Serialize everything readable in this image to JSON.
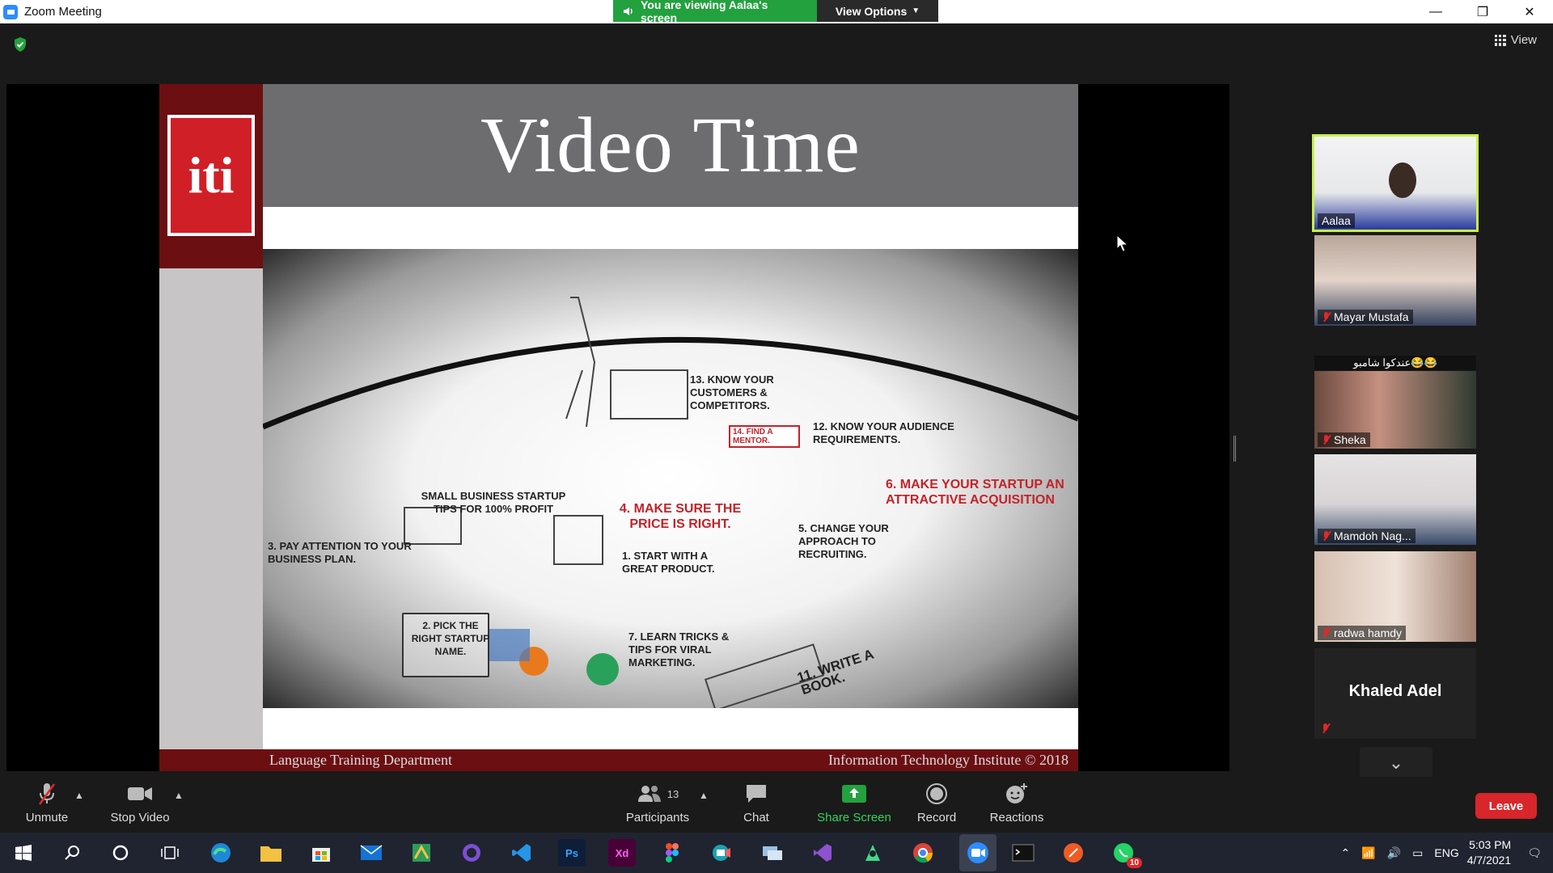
{
  "window": {
    "title": "Zoom Meeting",
    "banner_text": "You are viewing Aalaa's screen",
    "view_options": "View Options",
    "minimize": "—",
    "restore": "❐",
    "close": "✕"
  },
  "meeting": {
    "view_label": "View"
  },
  "slide": {
    "title": "Video Time",
    "logo_text": "iti",
    "footer_left": "Language Training Department",
    "footer_right": "Information Technology Institute © 2018",
    "video_labels": {
      "t13": "13. Know your customers & competitors.",
      "t12": "12. Know your audience requirements.",
      "t14": "14. Find a mentor.",
      "t6": "6. Make your startup an attractive acquisition",
      "small": "Small business startup tips for 100% profit",
      "t4": "4. Make sure the price is right.",
      "t5": "5. Change your approach to recruiting.",
      "t3": "3. Pay attention to your business plan.",
      "t1": "1. Start with a great product.",
      "t2": "2. Pick the right startup name.",
      "t7": "7. Learn tricks & tips for viral marketing.",
      "t11": "11. Write a book."
    }
  },
  "participants": [
    {
      "name": "Aalaa",
      "muted": false,
      "active": true
    },
    {
      "name": "Mayar Mustafa",
      "muted": true
    },
    {
      "name": "Sheka",
      "muted": true,
      "reaction": "عندكوا شامبو😂😂"
    },
    {
      "name": "Mamdoh Nag...",
      "muted": true
    },
    {
      "name": "radwa hamdy",
      "muted": true
    },
    {
      "name": "Khaled Adel",
      "muted": true,
      "video_off": true
    }
  ],
  "controls": {
    "unmute": "Unmute",
    "stop_video": "Stop Video",
    "participants": "Participants",
    "participants_count": "13",
    "chat": "Chat",
    "share_screen": "Share Screen",
    "record": "Record",
    "reactions": "Reactions",
    "leave": "Leave"
  },
  "taskbar": {
    "language": "ENG",
    "time": "5:03 PM",
    "date": "4/7/2021",
    "whatsapp_badge": "10",
    "apps": [
      "start",
      "search",
      "cortana",
      "task-view",
      "edge",
      "file-explorer",
      "store",
      "mail",
      "maps",
      "github",
      "vscode",
      "photoshop",
      "xd",
      "figma",
      "teams-camera",
      "remote",
      "visual-studio",
      "android-studio",
      "chrome",
      "zoom",
      "terminal",
      "postman",
      "whatsapp"
    ]
  },
  "colors": {
    "zoom_green": "#23a13e",
    "leave_red": "#d8262b",
    "slide_maroon": "#6b0f12",
    "active_speaker": "#c8f04a"
  }
}
